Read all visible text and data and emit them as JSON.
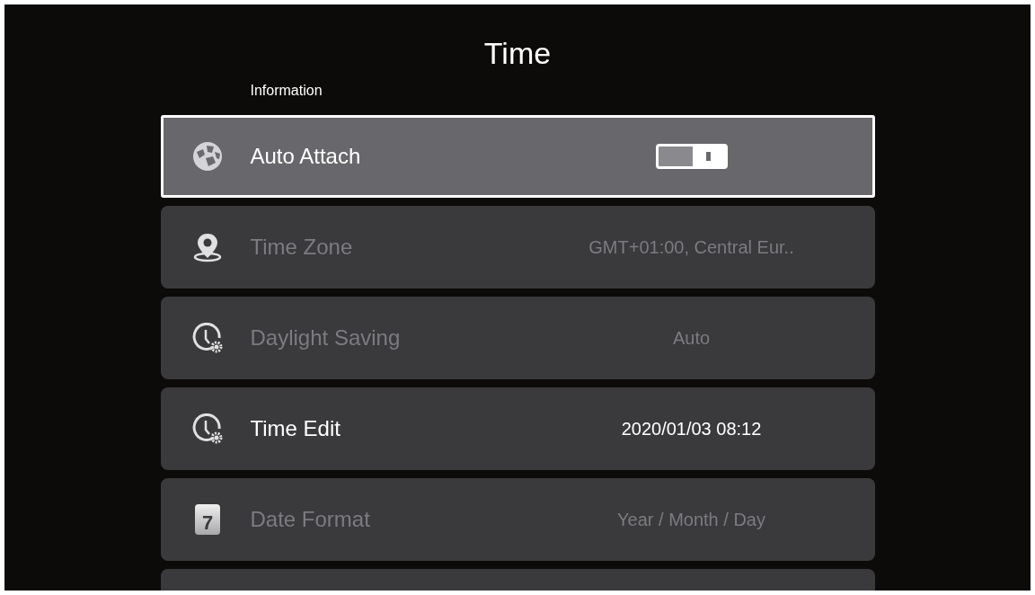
{
  "title": "Time",
  "section": "Information",
  "items": [
    {
      "kind": "toggle",
      "label": "Auto Attach",
      "on": true,
      "selected": true,
      "disabled": false
    },
    {
      "kind": "value",
      "label": "Time Zone",
      "value": "GMT+01:00, Central Eur..",
      "selected": false,
      "disabled": true
    },
    {
      "kind": "value",
      "label": "Daylight Saving",
      "value": "Auto",
      "selected": false,
      "disabled": true
    },
    {
      "kind": "value",
      "label": "Time Edit",
      "value": "2020/01/03 08:12",
      "selected": false,
      "disabled": false
    },
    {
      "kind": "value",
      "icon_text": "7",
      "label": "Date Format",
      "value": "Year / Month / Day",
      "selected": false,
      "disabled": true
    },
    {
      "kind": "empty",
      "selected": false
    }
  ]
}
